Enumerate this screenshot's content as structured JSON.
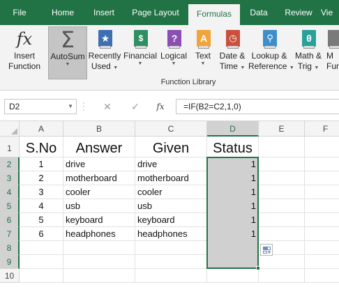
{
  "ribbon_tabs": [
    "File",
    "Home",
    "Insert",
    "Page Layout",
    "Formulas",
    "Data",
    "Review",
    "Vie"
  ],
  "active_tab": "Formulas",
  "ribbon": {
    "insert_function": {
      "line1": "Insert",
      "line2": "Function",
      "icon": "fx-icon"
    },
    "autosum": {
      "label": "AutoSum",
      "icon": "sigma-icon"
    },
    "recently_used": {
      "line1": "Recently",
      "line2": "Used",
      "icon": "star-book-icon"
    },
    "financial": {
      "label": "Financial",
      "icon": "coins-book-icon"
    },
    "logical": {
      "label": "Logical",
      "icon": "question-book-icon"
    },
    "text": {
      "label": "Text",
      "icon": "text-book-icon"
    },
    "date_time": {
      "line1": "Date &",
      "line2": "Time",
      "icon": "clock-book-icon"
    },
    "lookup_reference": {
      "line1": "Lookup &",
      "line2": "Reference",
      "icon": "magnifier-book-icon"
    },
    "math_trig": {
      "line1": "Math &",
      "line2": "Trig",
      "icon": "theta-book-icon"
    },
    "more": {
      "line1": "M",
      "line2": "Fun",
      "icon": "more-book-icon"
    },
    "group_label": "Function Library"
  },
  "formula_bar": {
    "name_box": "D2",
    "cancel_glyph": "✕",
    "enter_glyph": "✓",
    "fx_label": "fx",
    "formula": "=IF(B2=C2,1,0)"
  },
  "grid": {
    "columns": [
      "A",
      "B",
      "C",
      "D",
      "E",
      "F"
    ],
    "selected_column": "D",
    "rows": [
      "1",
      "2",
      "3",
      "4",
      "5",
      "6",
      "7",
      "8",
      "9",
      "10"
    ],
    "headers": {
      "A": "S.No",
      "B": "Answer",
      "C": "Given",
      "D": "Status"
    },
    "data": [
      {
        "sno": "1",
        "answer": "drive",
        "given": "drive",
        "status": "1"
      },
      {
        "sno": "2",
        "answer": "motherboard",
        "given": "motherboard",
        "status": "1"
      },
      {
        "sno": "3",
        "answer": "cooler",
        "given": "cooler",
        "status": "1"
      },
      {
        "sno": "4",
        "answer": "usb",
        "given": "usb",
        "status": "1"
      },
      {
        "sno": "5",
        "answer": "keyboard",
        "given": "keyboard",
        "status": "1"
      },
      {
        "sno": "6",
        "answer": "headphones",
        "given": "headphones",
        "status": "1"
      }
    ]
  },
  "colors": {
    "accent": "#217346",
    "selection_fill": "#d0d0d0"
  }
}
